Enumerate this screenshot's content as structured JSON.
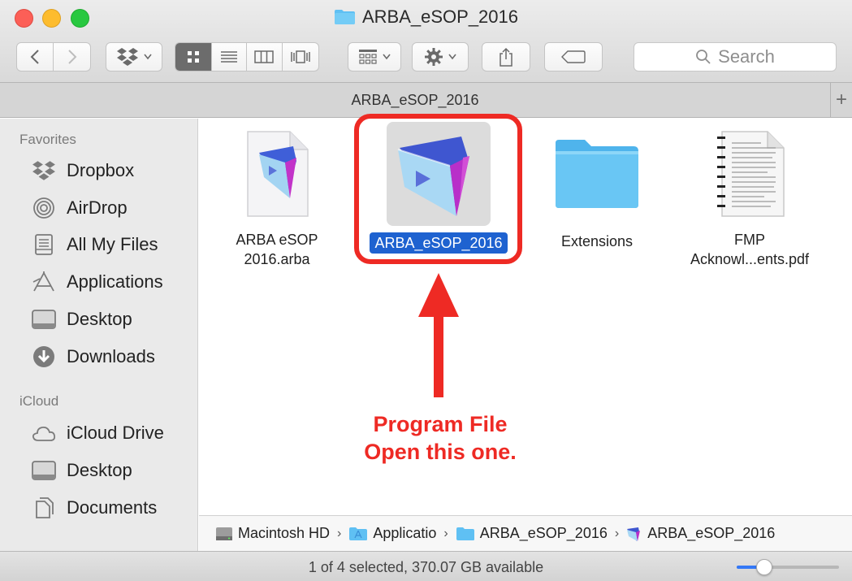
{
  "window": {
    "title": "ARBA_eSOP_2016"
  },
  "toolbar": {
    "search_placeholder": "Search",
    "search_icon": "magnifier-icon"
  },
  "tabbar": {
    "title": "ARBA_eSOP_2016",
    "plus": "+"
  },
  "sidebar": {
    "favorites_header": "Favorites",
    "favorites": [
      {
        "label": "Dropbox",
        "icon": "dropbox-icon"
      },
      {
        "label": "AirDrop",
        "icon": "airdrop-icon"
      },
      {
        "label": "All My Files",
        "icon": "all-files-icon"
      },
      {
        "label": "Applications",
        "icon": "applications-icon"
      },
      {
        "label": "Desktop",
        "icon": "desktop-icon"
      },
      {
        "label": "Downloads",
        "icon": "downloads-icon"
      }
    ],
    "icloud_header": "iCloud",
    "icloud": [
      {
        "label": "iCloud Drive",
        "icon": "cloud-icon"
      },
      {
        "label": "Desktop",
        "icon": "desktop-icon"
      },
      {
        "label": "Documents",
        "icon": "documents-icon"
      }
    ]
  },
  "files": [
    {
      "line1": "ARBA eSOP",
      "line2": "2016.arba",
      "icon": "filemaker-doc-icon"
    },
    {
      "line1": "ARBA_eSOP_2016",
      "line2": "",
      "icon": "filemaker-app-icon",
      "selected": true
    },
    {
      "line1": "Extensions",
      "line2": "",
      "icon": "folder-icon"
    },
    {
      "line1": "FMP",
      "line2": "Acknowl...ents.pdf",
      "icon": "pdf-icon"
    }
  ],
  "annotation": {
    "line1": "Program File",
    "line2": "Open this one."
  },
  "pathbar": [
    "Macintosh HD",
    "Applicatio",
    "ARBA_eSOP_2016",
    "ARBA_eSOP_2016"
  ],
  "status": {
    "text": "1 of 4 selected, 370.07 GB available"
  },
  "icon_size_slider": {
    "value": 0.27
  },
  "colors": {
    "selection": "#1e62d0",
    "annotation_red": "#ee2a24",
    "folder_blue": "#5fc0f3"
  }
}
